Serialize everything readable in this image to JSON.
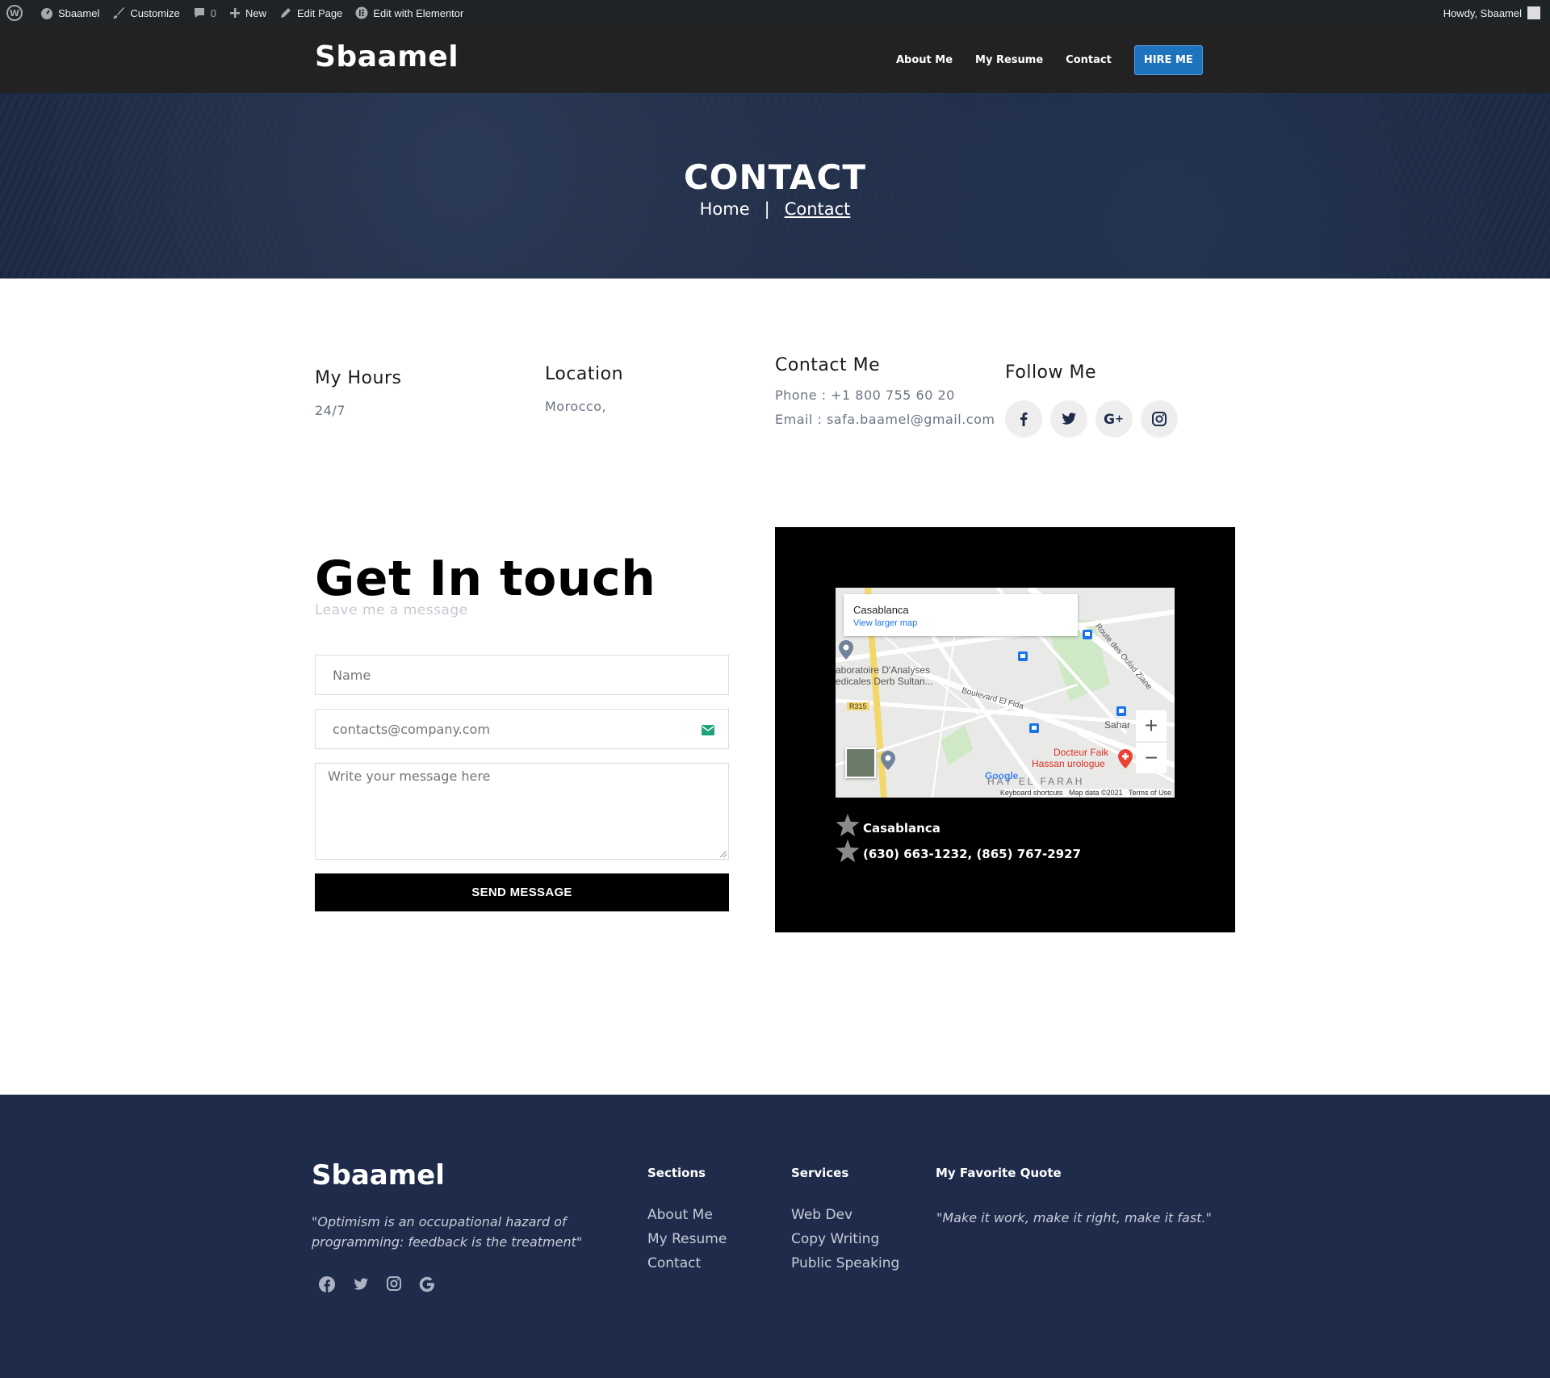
{
  "adminbar": {
    "site": "Sbaamel",
    "customize": "Customize",
    "comments": "0",
    "new": "New",
    "edit_page": "Edit Page",
    "edit_elementor": "Edit with Elementor",
    "howdy": "Howdy, Sbaamel"
  },
  "header": {
    "logo": "Sbaamel",
    "nav": [
      "About Me",
      "My Resume",
      "Contact"
    ],
    "cta": "HIRE ME"
  },
  "hero": {
    "title": "CONTACT",
    "crumb_home": "Home",
    "crumb_sep": "|",
    "crumb_current": "Contact"
  },
  "info": {
    "hours_title": "My Hours",
    "hours_value": "24/7",
    "location_title": "Location",
    "location_value": "Morocco,",
    "contact_title": "Contact Me",
    "phone": "Phone : +1 800 755 60 20",
    "email": "Email : safa.baamel@gmail.com",
    "follow_title": "Follow Me",
    "social_icons": [
      "facebook-icon",
      "twitter-icon",
      "google-plus-icon",
      "instagram-icon"
    ]
  },
  "form": {
    "title": "Get In touch",
    "subtitle": "Leave me a message",
    "name_placeholder": "Name",
    "email_placeholder": "contacts@company.com",
    "message_placeholder": "Write your message here",
    "submit": "SEND MESSAGE"
  },
  "map": {
    "card_title": "Casablanca",
    "card_link": "View larger map",
    "labels": {
      "lab": "aboratoire D'Analyses",
      "lab2": "edicales Derb Sultan...",
      "boulevard": "Boulevard El Fida",
      "route": "Route des Oulad Ziane",
      "sahar": "Sahar",
      "doctor": "Docteur Faik",
      "doctor2": "Hassan urologue",
      "district": "HAY EL FARAH",
      "road": "R315",
      "google": "Google"
    },
    "footer_keys": "Keyboard shortcuts",
    "footer_data": "Map data ©2021",
    "footer_terms": "Terms of Use",
    "city": "Casablanca",
    "phones": "(630) 663-1232, (865) 767-2927"
  },
  "footer": {
    "logo": "Sbaamel",
    "quote": "\"Optimism is an occupational hazard of programming: feedback is the treatment\"",
    "sections_title": "Sections",
    "sections": [
      "About Me",
      "My Resume",
      "Contact"
    ],
    "services_title": "Services",
    "services": [
      "Web Dev",
      "Copy Writing",
      "Public Speaking"
    ],
    "quote_title": "My Favorite Quote",
    "fav_quote": "\"Make it work, make it right, make it fast.\"",
    "social_icons": [
      "facebook-icon",
      "twitter-icon",
      "instagram-icon",
      "google-icon"
    ]
  },
  "colors": {
    "admin_bg": "#1d2327",
    "header_bg": "#222222",
    "accent": "#1e73be",
    "footer_bg": "#1e2b4a"
  }
}
